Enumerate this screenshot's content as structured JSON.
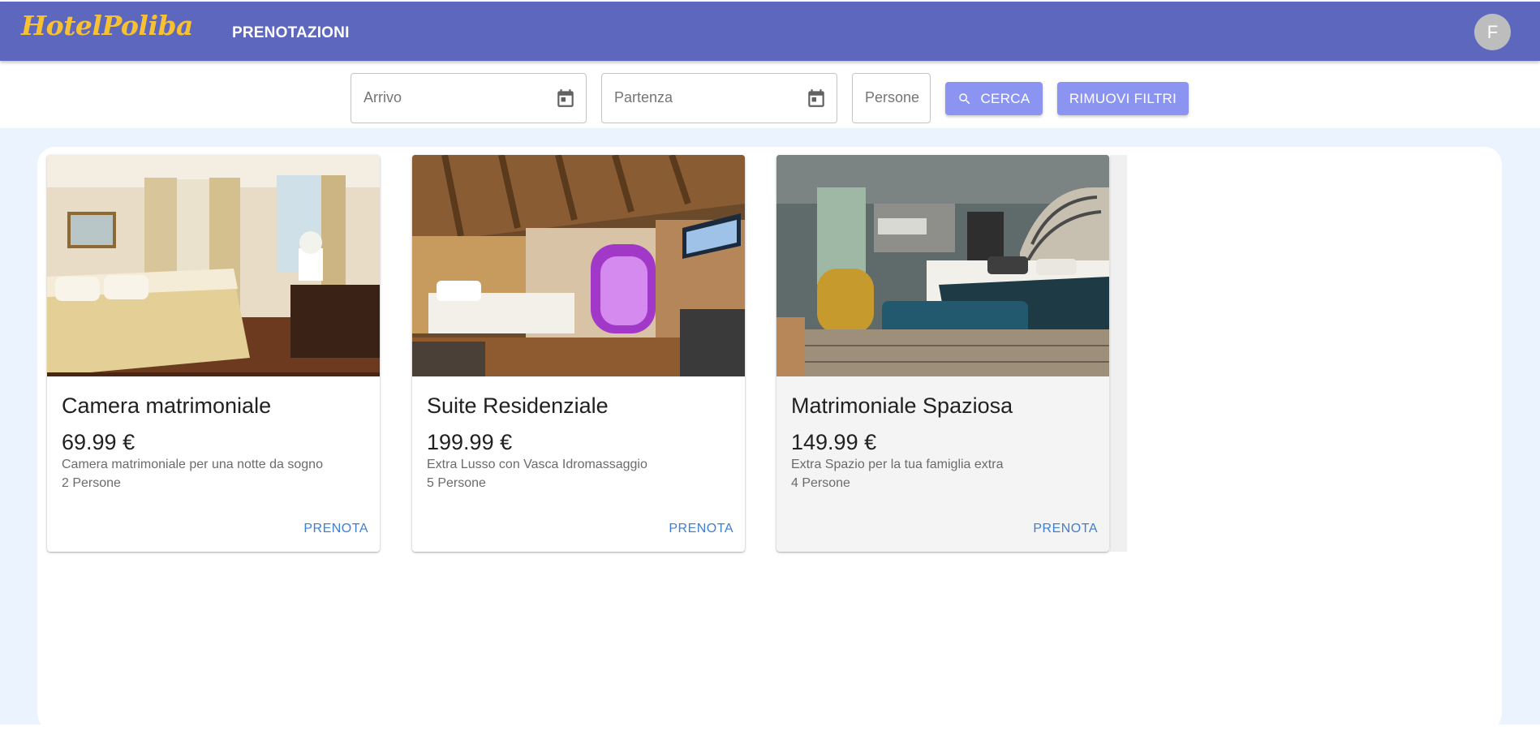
{
  "header": {
    "logo": "HotelPoliba",
    "nav_label": "PRENOTAZIONI",
    "avatar_letter": "F"
  },
  "filters": {
    "arrival_placeholder": "Arrivo",
    "departure_placeholder": "Partenza",
    "persons_placeholder": "Persone",
    "search_label": "CERCA",
    "clear_label": "RIMUOVI FILTRI"
  },
  "rooms": [
    {
      "title": "Camera matrimoniale",
      "price": "69.99 €",
      "description": "Camera matrimoniale per una notte da sogno",
      "persons": "2 Persone",
      "action": "PRENOTA"
    },
    {
      "title": "Suite Residenziale",
      "price": "199.99 €",
      "description": "Extra Lusso con Vasca Idromassaggio",
      "persons": "5 Persone",
      "action": "PRENOTA"
    },
    {
      "title": "Matrimoniale Spaziosa",
      "price": "149.99 €",
      "description": "Extra Spazio per la tua famiglia extra",
      "persons": "4 Persone",
      "action": "PRENOTA"
    }
  ],
  "colors": {
    "appbar": "#5c67bd",
    "logo": "#f8c132",
    "button": "#8c94f2",
    "link": "#3f7fcf",
    "background": "#ebf4fe"
  },
  "icons": [
    "calendar-icon",
    "search-icon"
  ]
}
